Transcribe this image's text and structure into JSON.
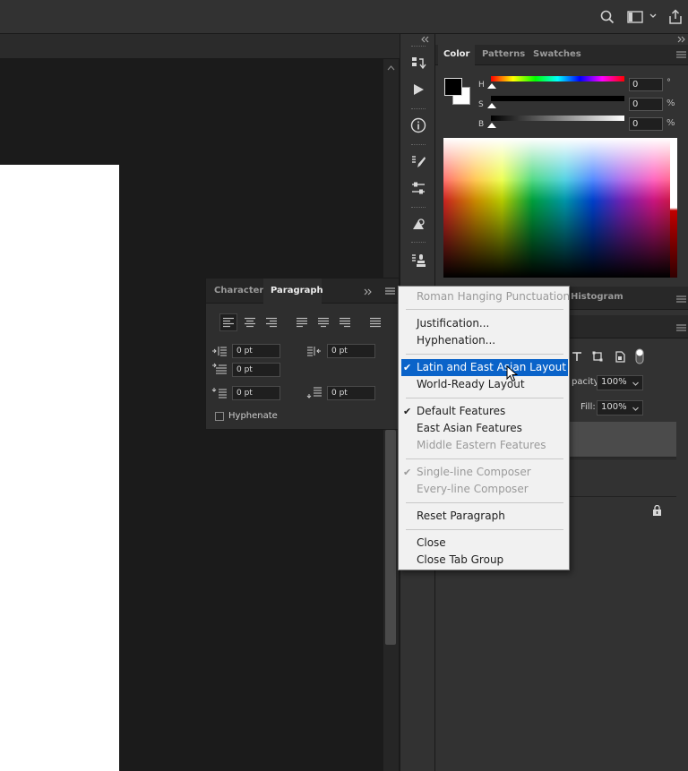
{
  "top_bar": {
    "icons": [
      "search-icon",
      "workspace-icon",
      "chevron-down-icon",
      "share-icon"
    ]
  },
  "color_panel": {
    "tabs": [
      "Color",
      "Patterns",
      "Swatches"
    ],
    "active_tab": "Color",
    "sliders": [
      {
        "label": "H",
        "value": "0",
        "unit": "°"
      },
      {
        "label": "S",
        "value": "0",
        "unit": "%"
      },
      {
        "label": "B",
        "value": "0",
        "unit": "%"
      }
    ]
  },
  "paragraph_panel": {
    "tabs": [
      "Character",
      "Paragraph"
    ],
    "active_tab": "Paragraph",
    "fields": {
      "indent_left": "0 pt",
      "indent_right": "0 pt",
      "indent_first": "0 pt",
      "space_before": "0 pt",
      "space_after": "0 pt"
    },
    "hyphenate_label": "Hyphenate"
  },
  "flyout_menu": {
    "items": [
      {
        "label": "Roman Hanging Punctuation",
        "disabled": true,
        "checked": false
      },
      {
        "label": "Justification...",
        "disabled": false,
        "checked": false
      },
      {
        "label": "Hyphenation...",
        "disabled": false,
        "checked": false
      },
      {
        "label": "Latin and East Asian Layout",
        "disabled": false,
        "checked": true,
        "highlighted": true
      },
      {
        "label": "World-Ready Layout",
        "disabled": false,
        "checked": false
      },
      {
        "label": "Default Features",
        "disabled": false,
        "checked": true
      },
      {
        "label": "East Asian Features",
        "disabled": false,
        "checked": false
      },
      {
        "label": "Middle Eastern Features",
        "disabled": true,
        "checked": false
      },
      {
        "label": "Single-line Composer",
        "disabled": true,
        "checked": true
      },
      {
        "label": "Every-line Composer",
        "disabled": true,
        "checked": false
      },
      {
        "label": "Reset Paragraph",
        "disabled": false,
        "checked": false
      },
      {
        "label": "Close",
        "disabled": false,
        "checked": false
      },
      {
        "label": "Close Tab Group",
        "disabled": false,
        "checked": false
      }
    ]
  },
  "layers_area": {
    "histogram_tab": "Histogram",
    "opacity_label": "pacity:",
    "opacity_value": "100%",
    "fill_label": "Fill:",
    "fill_value": "100%"
  }
}
